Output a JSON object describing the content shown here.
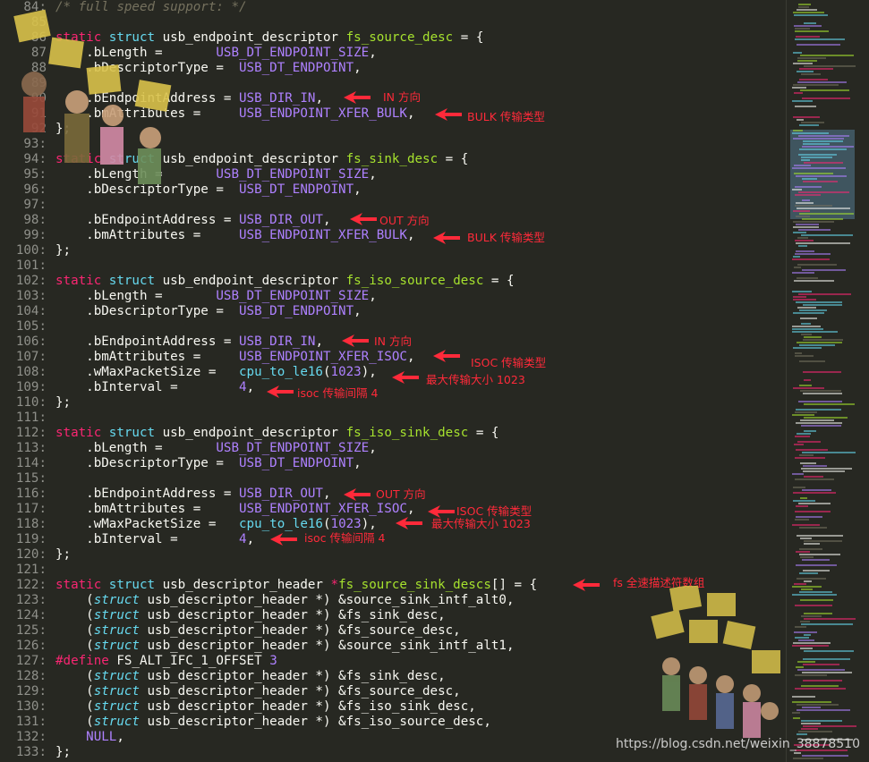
{
  "editor": {
    "lines": [
      {
        "n": "84:",
        "html": "<span class='cm'>/* full speed support: */</span>"
      },
      {
        "n": "85",
        "html": ""
      },
      {
        "n": "86",
        "html": "<span class='kw'>static</span> <span class='ty'>struct</span> <span class='pl'>usb_endpoint_descriptor</span> <span class='fn'>fs_source_desc</span> <span class='pl'>= {</span>"
      },
      {
        "n": "87",
        "html": "    <span class='pl'>.bLength =      </span> <span class='mc'>USB_DT_ENDPOINT_SIZE</span><span class='pl'>,</span>"
      },
      {
        "n": "88",
        "html": "    <span class='pl'>.bDescriptorType = </span> <span class='mc'>USB_DT_ENDPOINT</span><span class='pl'>,</span>"
      },
      {
        "n": "89",
        "html": ""
      },
      {
        "n": "90",
        "html": "    <span class='pl'>.bEndpointAddress = </span><span class='mc'>USB_DIR_IN</span><span class='pl'>,</span>"
      },
      {
        "n": "91",
        "html": "    <span class='pl'>.bmAttributes =     </span><span class='mc'>USB_ENDPOINT_XFER_BULK</span><span class='pl'>,</span>"
      },
      {
        "n": "92",
        "html": "<span class='pl'>};</span>"
      },
      {
        "n": "93:",
        "html": ""
      },
      {
        "n": "94:",
        "html": "<span class='kw'>static</span> <span class='ty'>struct</span> <span class='pl'>usb_endpoint_descriptor</span> <span class='fn'>fs_sink_desc</span> <span class='pl'>= {</span>"
      },
      {
        "n": "95:",
        "html": "    <span class='pl'>.bLength =      </span> <span class='mc'>USB_DT_ENDPOINT_SIZE</span><span class='pl'>,</span>"
      },
      {
        "n": "96:",
        "html": "    <span class='pl'>.bDescriptorType = </span> <span class='mc'>USB_DT_ENDPOINT</span><span class='pl'>,</span>"
      },
      {
        "n": "97:",
        "html": ""
      },
      {
        "n": "98:",
        "html": "    <span class='pl'>.bEndpointAddress = </span><span class='mc'>USB_DIR_OUT</span><span class='pl'>,</span>"
      },
      {
        "n": "99:",
        "html": "    <span class='pl'>.bmAttributes =     </span><span class='mc'>USB_ENDPOINT_XFER_BULK</span><span class='pl'>,</span>"
      },
      {
        "n": "100:",
        "html": "<span class='pl'>};</span>"
      },
      {
        "n": "101:",
        "html": ""
      },
      {
        "n": "102:",
        "html": "<span class='kw'>static</span> <span class='ty'>struct</span> <span class='pl'>usb_endpoint_descriptor</span> <span class='fn'>fs_iso_source_desc</span> <span class='pl'>= {</span>"
      },
      {
        "n": "103:",
        "html": "    <span class='pl'>.bLength =      </span> <span class='mc'>USB_DT_ENDPOINT_SIZE</span><span class='pl'>,</span>"
      },
      {
        "n": "104:",
        "html": "    <span class='pl'>.bDescriptorType = </span> <span class='mc'>USB_DT_ENDPOINT</span><span class='pl'>,</span>"
      },
      {
        "n": "105:",
        "html": ""
      },
      {
        "n": "106:",
        "html": "    <span class='pl'>.bEndpointAddress = </span><span class='mc'>USB_DIR_IN</span><span class='pl'>,</span>"
      },
      {
        "n": "107:",
        "html": "    <span class='pl'>.bmAttributes =     </span><span class='mc'>USB_ENDPOINT_XFER_ISOC</span><span class='pl'>,</span>"
      },
      {
        "n": "108:",
        "html": "    <span class='pl'>.wMaxPacketSize =   </span><span class='fc'>cpu_to_le16</span><span class='pl'>(</span><span class='num'>1023</span><span class='pl'>),</span>"
      },
      {
        "n": "109:",
        "html": "    <span class='pl'>.bInterval =        </span><span class='num'>4</span><span class='pl'>,</span>"
      },
      {
        "n": "110:",
        "html": "<span class='pl'>};</span>"
      },
      {
        "n": "111:",
        "html": ""
      },
      {
        "n": "112:",
        "html": "<span class='kw'>static</span> <span class='ty'>struct</span> <span class='pl'>usb_endpoint_descriptor</span> <span class='fn'>fs_iso_sink_desc</span> <span class='pl'>= {</span>"
      },
      {
        "n": "113:",
        "html": "    <span class='pl'>.bLength =      </span> <span class='mc'>USB_DT_ENDPOINT_SIZE</span><span class='pl'>,</span>"
      },
      {
        "n": "114:",
        "html": "    <span class='pl'>.bDescriptorType = </span> <span class='mc'>USB_DT_ENDPOINT</span><span class='pl'>,</span>"
      },
      {
        "n": "115:",
        "html": ""
      },
      {
        "n": "116:",
        "html": "    <span class='pl'>.bEndpointAddress = </span><span class='mc'>USB_DIR_OUT</span><span class='pl'>,</span>"
      },
      {
        "n": "117:",
        "html": "    <span class='pl'>.bmAttributes =     </span><span class='mc'>USB_ENDPOINT_XFER_ISOC</span><span class='pl'>,</span>"
      },
      {
        "n": "118:",
        "html": "    <span class='pl'>.wMaxPacketSize =   </span><span class='fc'>cpu_to_le16</span><span class='pl'>(</span><span class='num'>1023</span><span class='pl'>),</span>"
      },
      {
        "n": "119:",
        "html": "    <span class='pl'>.bInterval =        </span><span class='num'>4</span><span class='pl'>,</span>"
      },
      {
        "n": "120:",
        "html": "<span class='pl'>};</span>"
      },
      {
        "n": "121:",
        "html": ""
      },
      {
        "n": "122:",
        "html": "<span class='kw'>static</span> <span class='ty'>struct</span> <span class='pl'>usb_descriptor_header</span> <span class='kw'>*</span><span class='fn'>fs_source_sink_descs</span><span class='pl'>[] = {</span>"
      },
      {
        "n": "123:",
        "html": "    <span class='pl'>(</span><span class='ital'>struct</span> <span class='pl'>usb_descriptor_header *) &amp;source_sink_intf_alt0,</span>"
      },
      {
        "n": "124:",
        "html": "    <span class='pl'>(</span><span class='ital'>struct</span> <span class='pl'>usb_descriptor_header *) &amp;fs_sink_desc,</span>"
      },
      {
        "n": "125:",
        "html": "    <span class='pl'>(</span><span class='ital'>struct</span> <span class='pl'>usb_descriptor_header *) &amp;fs_source_desc,</span>"
      },
      {
        "n": "126:",
        "html": "    <span class='pl'>(</span><span class='ital'>struct</span> <span class='pl'>usb_descriptor_header *) &amp;source_sink_intf_alt1,</span>"
      },
      {
        "n": "127:",
        "html": "<span class='kw'>#define</span> <span class='pl'>FS_ALT_IFC_1_OFFSET</span> <span class='num'>3</span>"
      },
      {
        "n": "128:",
        "html": "    <span class='pl'>(</span><span class='ital'>struct</span> <span class='pl'>usb_descriptor_header *) &amp;fs_sink_desc,</span>"
      },
      {
        "n": "129:",
        "html": "    <span class='pl'>(</span><span class='ital'>struct</span> <span class='pl'>usb_descriptor_header *) &amp;fs_source_desc,</span>"
      },
      {
        "n": "130:",
        "html": "    <span class='pl'>(</span><span class='ital'>struct</span> <span class='pl'>usb_descriptor_header *) &amp;fs_iso_sink_desc,</span>"
      },
      {
        "n": "131:",
        "html": "    <span class='pl'>(</span><span class='ital'>struct</span> <span class='pl'>usb_descriptor_header *) &amp;fs_iso_source_desc,</span>"
      },
      {
        "n": "132:",
        "html": "    <span class='mc'>NULL</span><span class='pl'>,</span>"
      },
      {
        "n": "133:",
        "html": "<span class='pl'>};</span>"
      }
    ]
  },
  "annotations": [
    "IN 方向",
    "BULK 传输类型",
    "OUT 方向",
    "BULK 传输类型",
    "IN 方向",
    "ISOC 传输类型",
    "最大传输大小 1023",
    "isoc 传输间隔 4",
    "OUT 方向",
    "ISOC 传输类型",
    "最大传输大小 1023",
    "isoc 传输间隔 4",
    "fs 全速描述符数组"
  ],
  "colors": {
    "background": "#272822",
    "annotation": "#ff2a3a",
    "keyword": "#f92672",
    "type": "#66d9ef",
    "function": "#a6e22e",
    "macro": "#ae81ff"
  },
  "watermark": "https://blog.csdn.net/weixin_38878510"
}
